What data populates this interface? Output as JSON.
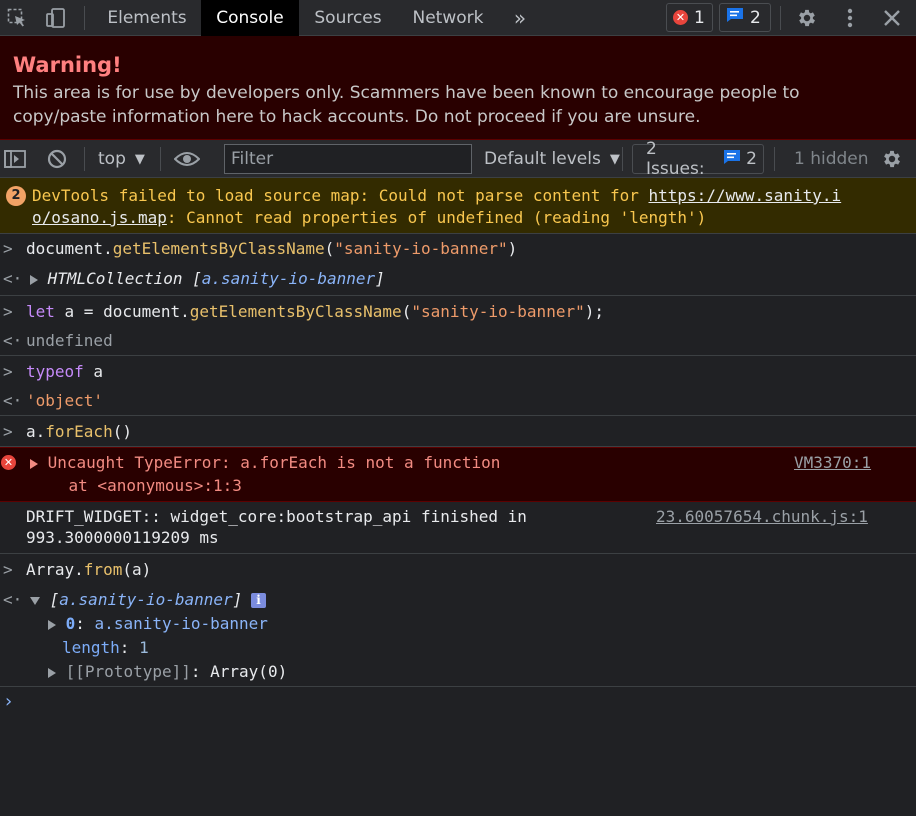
{
  "tabs": {
    "elements": "Elements",
    "console": "Console",
    "sources": "Sources",
    "network": "Network",
    "more": "»"
  },
  "counts": {
    "errors": "1",
    "messages": "2"
  },
  "warning": {
    "title": "Warning!",
    "body": "This area is for use by developers only. Scammers have been known to encourage people to copy/paste information here to hack accounts. Do not proceed if you are unsure."
  },
  "toolbar": {
    "context": "top",
    "filter_placeholder": "Filter",
    "levels": "Default levels",
    "issues_label": "2 Issues:",
    "issues_count": "2",
    "hidden": "1 hidden"
  },
  "console": {
    "source_map_warning": {
      "count": "2",
      "text1": "DevTools failed to load source map: Could not parse content for ",
      "url1": "https://www.sanity.i",
      "url2": "o/osano.js.map",
      "text2": ": Cannot read properties of undefined (reading 'length')"
    },
    "cmd1": {
      "obj": "document.",
      "fn": "getElementsByClassName",
      "open": "(",
      "str": "\"sanity-io-banner\"",
      "close": ")"
    },
    "res1": {
      "type": "HTMLCollection ",
      "open": "[",
      "item": "a.sanity-io-banner",
      "close": "]"
    },
    "cmd2": {
      "kw": "let",
      "mid": " a = document.",
      "fn": "getElementsByClassName",
      "open": "(",
      "str": "\"sanity-io-banner\"",
      "close": ");"
    },
    "res2": "undefined",
    "cmd3": {
      "kw": "typeof",
      "rest": " a"
    },
    "res3": "'object'",
    "cmd4": {
      "obj": "a.",
      "fn": "forEach",
      "rest": "()"
    },
    "error": {
      "line1": "Uncaught TypeError: a.forEach is not a function",
      "line2": "    at <anonymous>:1:3",
      "source": "VM3370:1"
    },
    "log": {
      "line1": "DRIFT_WIDGET:: widget_core:bootstrap_api finished in",
      "line2": "993.3000000119209 ms",
      "source": "23.60057654.chunk.js:1"
    },
    "cmd5": {
      "obj": "Array.",
      "fn": "from",
      "rest": "(a)"
    },
    "res5": {
      "open": "[",
      "item": "a.sanity-io-banner",
      "close": "]",
      "info": "i",
      "entry0_key": "0",
      "entry0_val": "a.sanity-io-banner",
      "length_key": "length",
      "length_val": "1",
      "proto_key": "[[Prototype]]",
      "proto_val": "Array(0)"
    },
    "prompt": "›"
  },
  "colors": {
    "background": "#202124",
    "toolbar": "#292a2d",
    "warning_bg": "#290000",
    "warning_title": "#ff8080",
    "error_bg": "#290000",
    "error_text": "#f28b82",
    "source_warning_bg": "#332b00",
    "source_warning_text": "#f9c74f",
    "badge_blue": "#1a73e8"
  }
}
